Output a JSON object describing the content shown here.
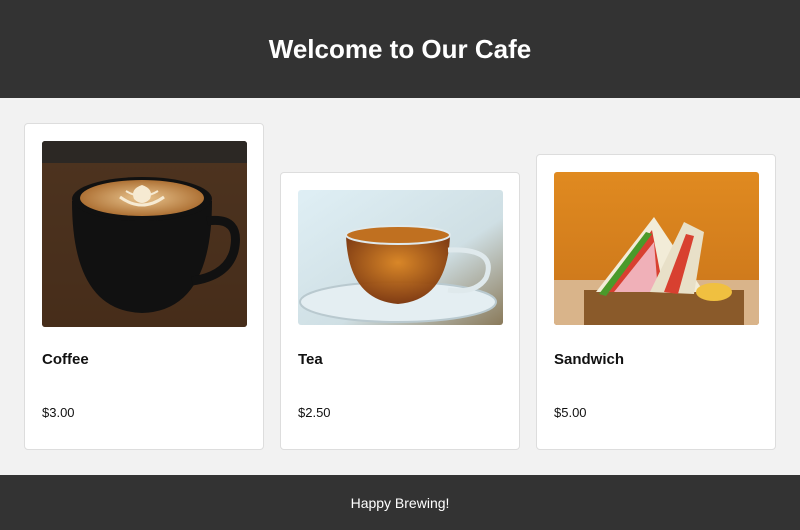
{
  "header": {
    "title": "Welcome to Our Cafe"
  },
  "menu": [
    {
      "name": "Coffee",
      "price": "$3.00",
      "image_icon": "coffee-latte-image"
    },
    {
      "name": "Tea",
      "price": "$2.50",
      "image_icon": "tea-cup-image"
    },
    {
      "name": "Sandwich",
      "price": "$5.00",
      "image_icon": "sandwich-image"
    }
  ],
  "footer": {
    "text": "Happy Brewing!"
  },
  "colors": {
    "bar": "#333333",
    "background": "#f2f2f2",
    "card": "#ffffff"
  }
}
